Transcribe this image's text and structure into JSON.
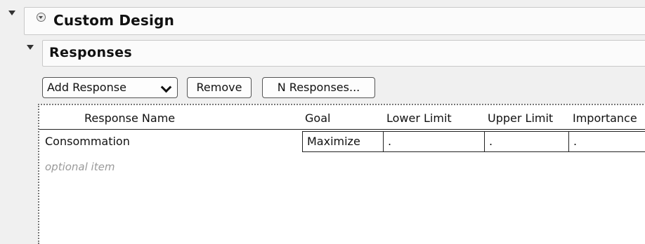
{
  "custom_design": {
    "title": "Custom Design"
  },
  "responses": {
    "title": "Responses",
    "toolbar": {
      "add_response_label": "Add Response",
      "remove_label": "Remove",
      "n_responses_label": "N Responses..."
    },
    "table": {
      "columns": [
        "Response Name",
        "Goal",
        "Lower Limit",
        "Upper Limit",
        "Importance"
      ],
      "rows": [
        {
          "response_name": "Consommation",
          "goal": "Maximize",
          "lower_limit": ".",
          "upper_limit": ".",
          "importance": "."
        }
      ],
      "placeholder": "optional item"
    }
  }
}
